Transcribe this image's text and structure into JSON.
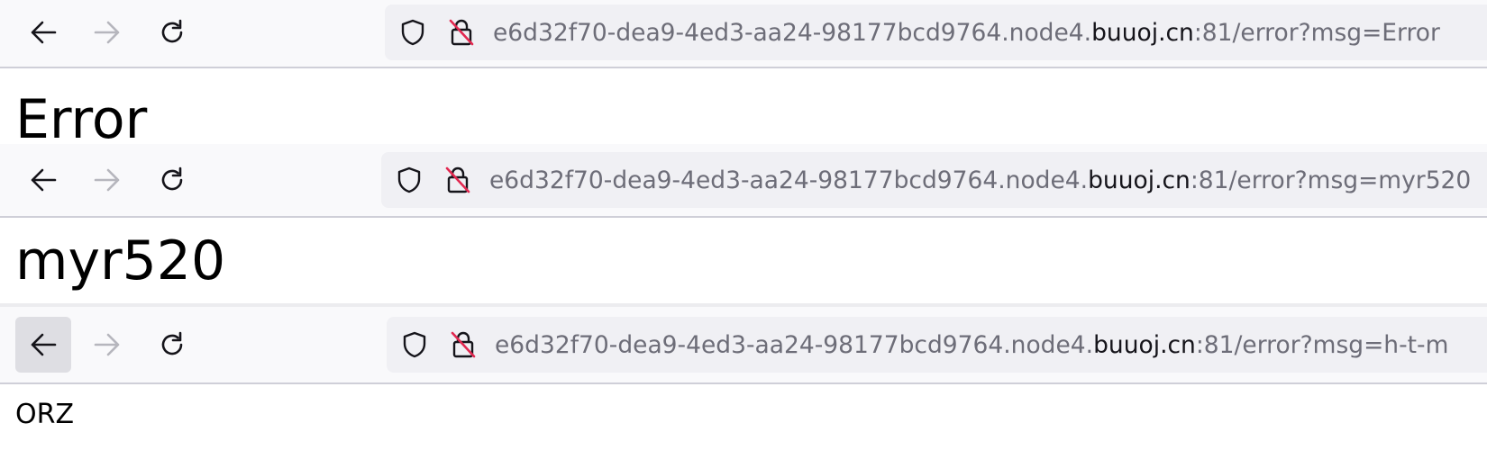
{
  "panels": [
    {
      "url": {
        "prefix": "e6d32f70-dea9-4ed3-aa24-98177bcd9764.node4.",
        "domain": "buuoj.cn",
        "suffix": ":81/error?msg=Error"
      },
      "content": "Error"
    },
    {
      "url": {
        "prefix": "e6d32f70-dea9-4ed3-aa24-98177bcd9764.node4.",
        "domain": "buuoj.cn",
        "suffix": ":81/error?msg=myr520"
      },
      "content": "myr520"
    },
    {
      "url": {
        "prefix": "e6d32f70-dea9-4ed3-aa24-98177bcd9764.node4.",
        "domain": "buuoj.cn",
        "suffix": ":81/error?msg=h-t-m"
      },
      "content": "ORZ"
    }
  ],
  "colors": {
    "toolbar_bg": "#f9f9fb",
    "urlbar_bg": "#f0f0f4",
    "url_dim": "#6d6d78",
    "url_domain": "#15141a",
    "lock_slash": "#e22850",
    "active_button_bg": "#dedee3"
  },
  "icons": [
    "back-arrow-icon",
    "forward-arrow-icon",
    "reload-icon",
    "tracking-shield-icon",
    "insecure-lock-icon"
  ]
}
